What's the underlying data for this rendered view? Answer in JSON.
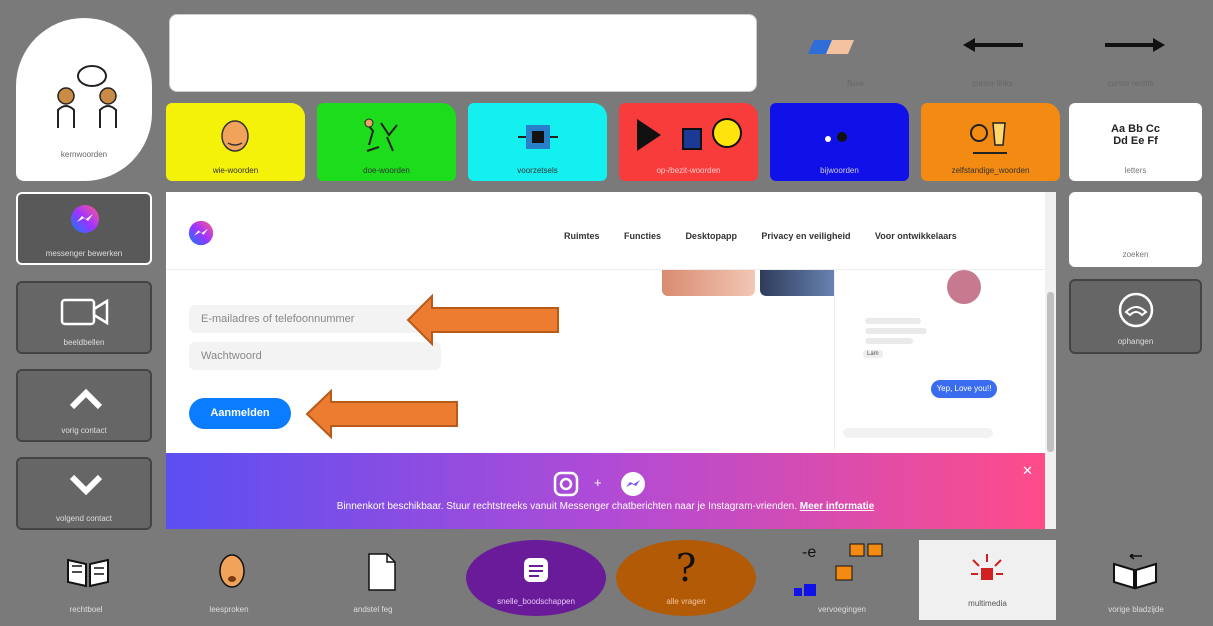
{
  "core_words": {
    "label": "kernwoorden"
  },
  "message_bar": {
    "value": ""
  },
  "top_buttons": [
    {
      "label": "fluxe",
      "icon": "eraser-icon"
    },
    {
      "label": "cursor links",
      "icon": "arrow-left-icon"
    },
    {
      "label": "cursor rechts",
      "icon": "arrow-right-icon"
    }
  ],
  "folders": [
    {
      "label": "wie-woorden",
      "color": "#f5f20a"
    },
    {
      "label": "doe-woorden",
      "color": "#1cdc1c"
    },
    {
      "label": "voorzetsels",
      "color": "#14f0f0"
    },
    {
      "label": "op-/bezit-woorden",
      "color": "#f83b3b"
    },
    {
      "label": "bijwoorden",
      "color": "#1010e8"
    },
    {
      "label": "zelfstandige_woorden",
      "color": "#f38a12"
    }
  ],
  "letters": {
    "text1": "Aa Bb Cc",
    "text2": "Dd Ee Ff",
    "label": "letters"
  },
  "side_left": [
    {
      "label": "messenger bewerken",
      "icon": "messenger-icon"
    },
    {
      "label": "beeldbellen",
      "icon": "video-camera-icon"
    },
    {
      "label": "vorig contact",
      "icon": "chevron-up-icon"
    },
    {
      "label": "volgend contact",
      "icon": "chevron-down-icon"
    }
  ],
  "side_right": [
    {
      "label": "zoeken"
    },
    {
      "label": "ophangen",
      "icon": "hang-up-icon"
    }
  ],
  "browser": {
    "nav": [
      "Ruimtes",
      "Functies",
      "Desktopapp",
      "Privacy en veiligheid",
      "Voor ontwikkelaars"
    ],
    "email_placeholder": "E-mailadres of telefoonnummer",
    "password_placeholder": "Wachtwoord",
    "login_button": "Aanmelden",
    "chat_bubble": "Yep, Love you!!",
    "chat_name": "Lam",
    "banner_plus": "+",
    "banner_text": "Binnenkort beschikbaar. Stuur rechtstreeks vanuit Messenger chatberichten naar je Instagram-vrienden.",
    "banner_link": "Meer informatie",
    "banner_close": "✕"
  },
  "bottom_buttons": [
    {
      "label": "rechtboel",
      "icon": "book-icon"
    },
    {
      "label": "leesproken",
      "icon": "speaking-face-icon"
    },
    {
      "label": "andstel feg",
      "icon": "document-icon"
    },
    {
      "label": "snelle_boodschappen",
      "icon": "message-icon",
      "color": "#6a1b9a"
    },
    {
      "label": "alle vragen",
      "icon": "question-mark-icon",
      "color": "#b35a06"
    },
    {
      "label": "vervoegingen",
      "icon": "shapes-icon"
    },
    {
      "label": "multimedia",
      "icon": "multimedia-icon"
    },
    {
      "label": "vorige bladzijde",
      "icon": "open-book-icon"
    }
  ],
  "bottom_texts": {
    "question_mark": "?",
    "verb_text": "-e"
  },
  "accent_colors": {
    "messenger_blue": "#0a7cff",
    "arrow_orange": "#ec7c30"
  }
}
